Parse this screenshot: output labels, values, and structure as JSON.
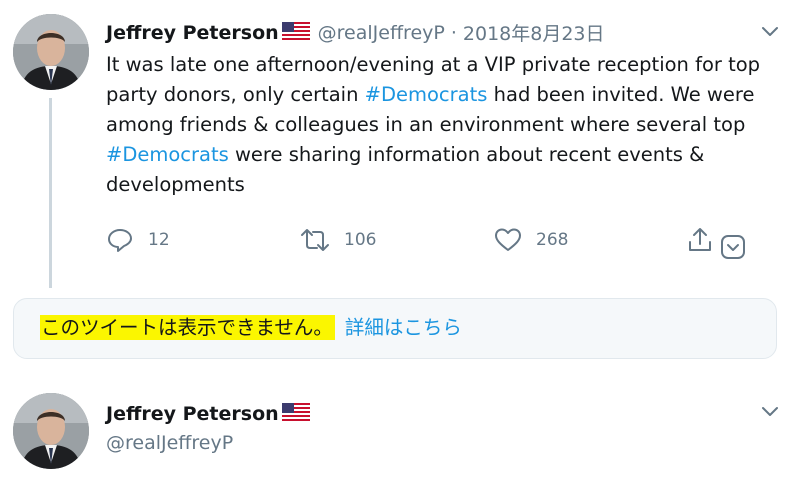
{
  "tweet1": {
    "author_name": "Jeffrey Peterson",
    "flag_emoji": "us-flag",
    "handle": "@realJeffreyP",
    "separator": "·",
    "date": "2018年8月23日",
    "text_segments": [
      {
        "text": "It was late one afternoon/evening at a VIP private reception for top party donors, only certain ",
        "hashtag": false
      },
      {
        "text": "#Democrats",
        "hashtag": true
      },
      {
        "text": " had been invited. We were among friends & colleagues in an environment where several top ",
        "hashtag": false
      },
      {
        "text": "#Democrats",
        "hashtag": true
      },
      {
        "text": " were sharing information about recent events & developments",
        "hashtag": false
      }
    ],
    "actions": {
      "reply_count": "12",
      "retweet_count": "106",
      "like_count": "268"
    }
  },
  "notice": {
    "unavailable_text": "このツイートは表示できません。",
    "learn_more_text": "詳細はこちら"
  },
  "tweet2": {
    "author_name": "Jeffrey Peterson",
    "handle": "@realJeffreyP"
  },
  "colors": {
    "text": "#14171a",
    "secondary": "#657786",
    "link": "#1b95e0",
    "highlight": "#fbf600",
    "thread_line": "#ccd6dd"
  }
}
